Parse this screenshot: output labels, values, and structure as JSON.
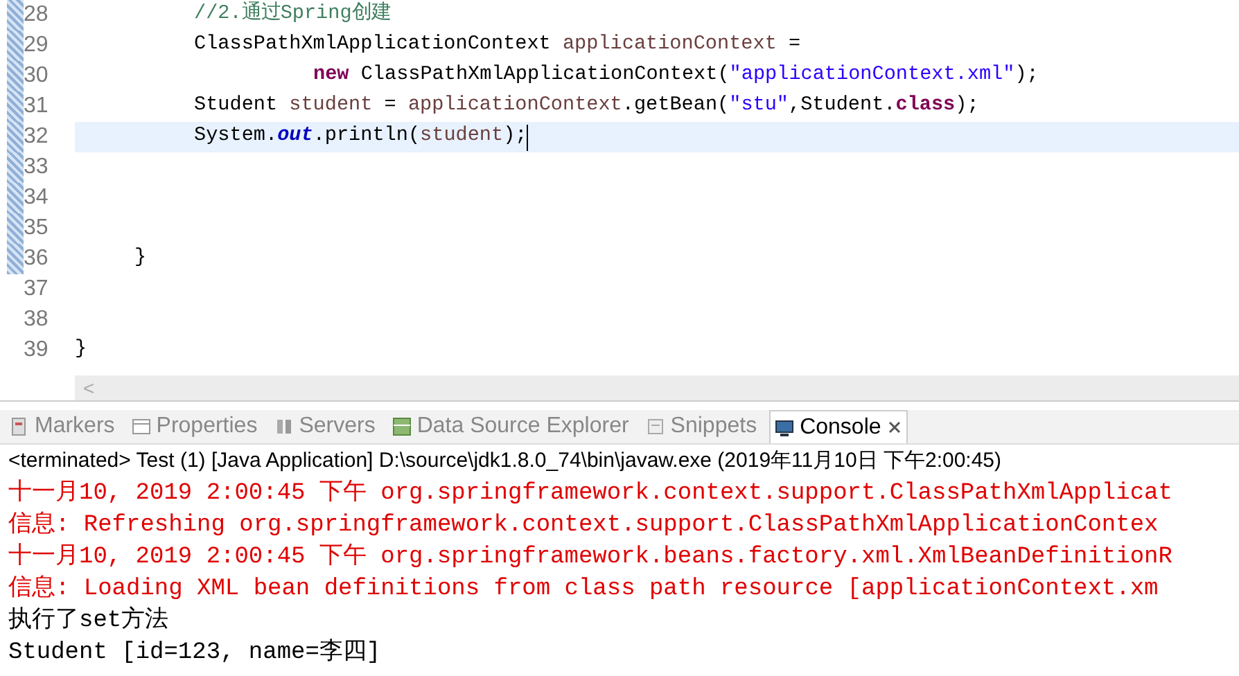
{
  "editor": {
    "lines": [
      {
        "number": "28",
        "changed": true,
        "current": false,
        "kind": "statement",
        "tokens": [
          {
            "text": "//2.通过Spring创建",
            "kind": "comment"
          }
        ]
      },
      {
        "number": "29",
        "changed": true,
        "current": false,
        "kind": "statement",
        "tokens": [
          {
            "text": "ClassPathXmlApplicationContext ",
            "kind": "plain"
          },
          {
            "text": "applicationContext",
            "kind": "local"
          },
          {
            "text": " =",
            "kind": "plain"
          }
        ]
      },
      {
        "number": "30",
        "changed": true,
        "current": false,
        "kind": "continuation",
        "tokens": [
          {
            "text": "new",
            "kind": "keyword"
          },
          {
            "text": " ClassPathXmlApplicationContext(",
            "kind": "plain"
          },
          {
            "text": "\"applicationContext.xml\"",
            "kind": "string"
          },
          {
            "text": ");",
            "kind": "plain"
          }
        ]
      },
      {
        "number": "31",
        "changed": true,
        "current": false,
        "kind": "statement",
        "tokens": [
          {
            "text": "Student ",
            "kind": "plain"
          },
          {
            "text": "student",
            "kind": "local"
          },
          {
            "text": " = ",
            "kind": "plain"
          },
          {
            "text": "applicationContext",
            "kind": "local"
          },
          {
            "text": ".getBean(",
            "kind": "plain"
          },
          {
            "text": "\"stu\"",
            "kind": "string"
          },
          {
            "text": ",Student.",
            "kind": "plain"
          },
          {
            "text": "class",
            "kind": "keyword"
          },
          {
            "text": ");",
            "kind": "plain"
          }
        ]
      },
      {
        "number": "32",
        "changed": true,
        "current": true,
        "kind": "statement",
        "tokens": [
          {
            "text": "System.",
            "kind": "plain"
          },
          {
            "text": "out",
            "kind": "field"
          },
          {
            "text": ".println(",
            "kind": "plain"
          },
          {
            "text": "student",
            "kind": "local"
          },
          {
            "text": ");",
            "kind": "plain"
          }
        ]
      },
      {
        "number": "33",
        "changed": true,
        "current": false,
        "kind": "statement"
      },
      {
        "number": "34",
        "changed": true,
        "current": false,
        "kind": "statement"
      },
      {
        "number": "35",
        "changed": true,
        "current": false,
        "kind": "statement"
      },
      {
        "number": "36",
        "changed": true,
        "current": false,
        "kind": "method_end",
        "tokens": [
          {
            "text": "}",
            "kind": "plain"
          }
        ]
      },
      {
        "number": "37",
        "changed": false,
        "current": false,
        "kind": "statement"
      },
      {
        "number": "38",
        "changed": false,
        "current": false,
        "kind": "statement"
      },
      {
        "number": "39",
        "changed": false,
        "current": false,
        "kind": "class_end",
        "tokens": [
          {
            "text": "}",
            "kind": "plain"
          }
        ]
      }
    ],
    "scroll_arrow": "<"
  },
  "panel": {
    "tabs": [
      {
        "label": "Markers",
        "selected": false,
        "kind": "markers"
      },
      {
        "label": "Properties",
        "selected": false,
        "kind": "properties"
      },
      {
        "label": "Servers",
        "selected": false,
        "kind": "servers"
      },
      {
        "label": "Data Source Explorer",
        "selected": false,
        "kind": "datasource"
      },
      {
        "label": "Snippets",
        "selected": false,
        "kind": "snippets"
      },
      {
        "label": "Console",
        "selected": true,
        "kind": "console"
      }
    ],
    "status": "<terminated> Test (1) [Java Application] D:\\source\\jdk1.8.0_74\\bin\\javaw.exe (2019年11月10日 下午2:00:45)",
    "output": [
      {
        "text": "十一月10, 2019 2:00:45 下午 org.springframework.context.support.ClassPathXmlApplicat",
        "kind": "error"
      },
      {
        "text": "信息: Refreshing org.springframework.context.support.ClassPathXmlApplicationContex",
        "kind": "error"
      },
      {
        "text": "十一月10, 2019 2:00:45 下午 org.springframework.beans.factory.xml.XmlBeanDefinitionR",
        "kind": "error"
      },
      {
        "text": "信息: Loading XML bean definitions from class path resource [applicationContext.xm",
        "kind": "error"
      },
      {
        "text": "执行了set方法",
        "kind": "out"
      },
      {
        "text": "Student [id=123, name=李四]",
        "kind": "out"
      }
    ]
  }
}
